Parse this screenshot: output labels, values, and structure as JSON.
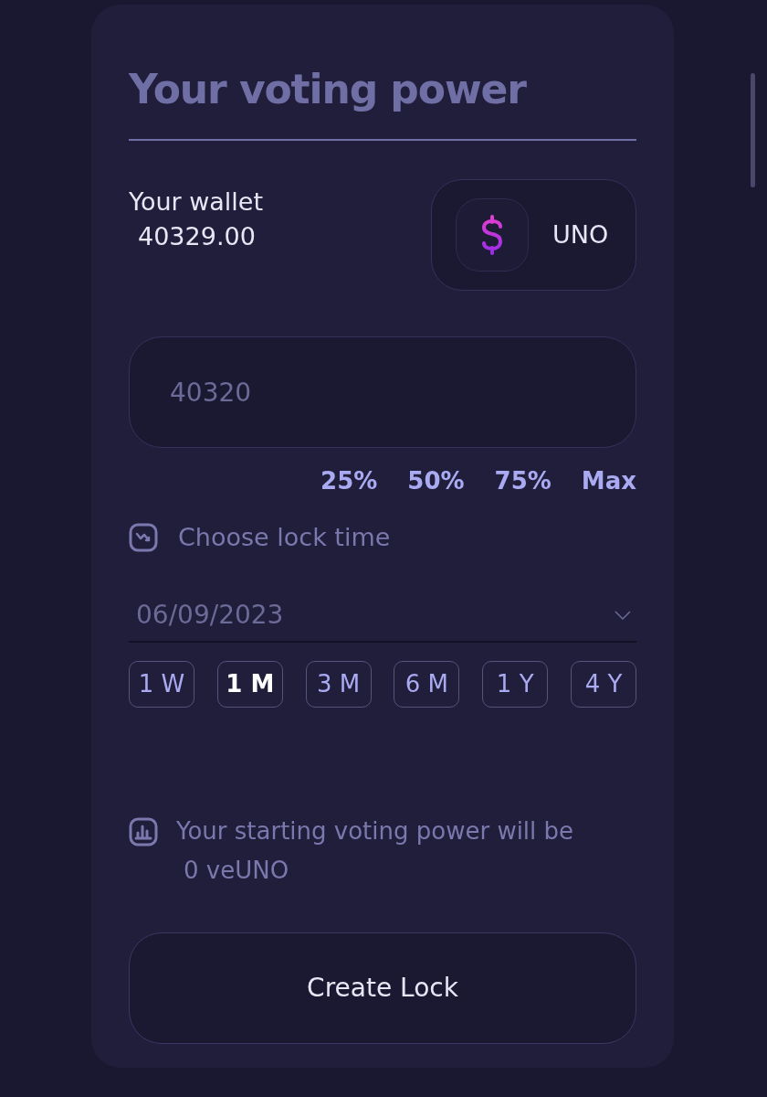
{
  "title": "Your voting power",
  "wallet": {
    "label": "Your wallet",
    "balance": "40329.00",
    "token": "UNO"
  },
  "amount": {
    "placeholder": "40320"
  },
  "percent_buttons": [
    "25%",
    "50%",
    "75%",
    "Max"
  ],
  "lock_time": {
    "label": "Choose lock time",
    "date": "06/09/2023"
  },
  "durations": [
    {
      "label": "1 W",
      "selected": false
    },
    {
      "label": "1 M",
      "selected": true
    },
    {
      "label": "3 M",
      "selected": false
    },
    {
      "label": "6 M",
      "selected": false
    },
    {
      "label": "1 Y",
      "selected": false
    },
    {
      "label": "4 Y",
      "selected": false
    }
  ],
  "voting_power": {
    "text": "Your starting voting power will be",
    "value": "0 veUNO"
  },
  "create_button": "Create Lock"
}
